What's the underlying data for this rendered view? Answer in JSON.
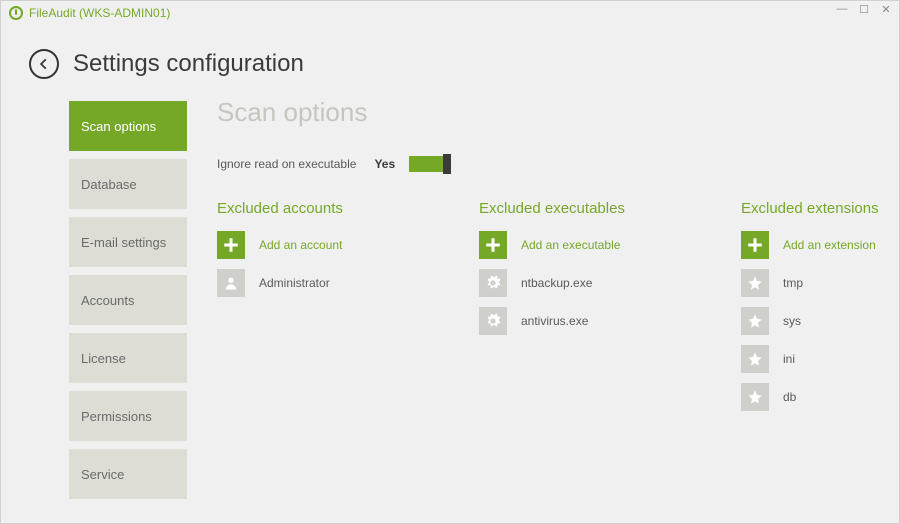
{
  "window": {
    "title": "FileAudit (WKS-ADMIN01)"
  },
  "page": {
    "title": "Settings configuration",
    "heading": "Scan options"
  },
  "sidebar": {
    "items": [
      {
        "label": "Scan options",
        "active": true
      },
      {
        "label": "Database",
        "active": false
      },
      {
        "label": "E-mail settings",
        "active": false
      },
      {
        "label": "Accounts",
        "active": false
      },
      {
        "label": "License",
        "active": false
      },
      {
        "label": "Permissions",
        "active": false
      },
      {
        "label": "Service",
        "active": false
      }
    ]
  },
  "toggle": {
    "label": "Ignore read on executable",
    "value": "Yes",
    "on": true
  },
  "columns": {
    "accounts": {
      "title": "Excluded accounts",
      "add_label": "Add an account",
      "items": [
        "Administrator"
      ]
    },
    "executables": {
      "title": "Excluded executables",
      "add_label": "Add an executable",
      "items": [
        "ntbackup.exe",
        "antivirus.exe"
      ]
    },
    "extensions": {
      "title": "Excluded extensions",
      "add_label": "Add an extension",
      "items": [
        "tmp",
        "sys",
        "ini",
        "db"
      ]
    }
  }
}
